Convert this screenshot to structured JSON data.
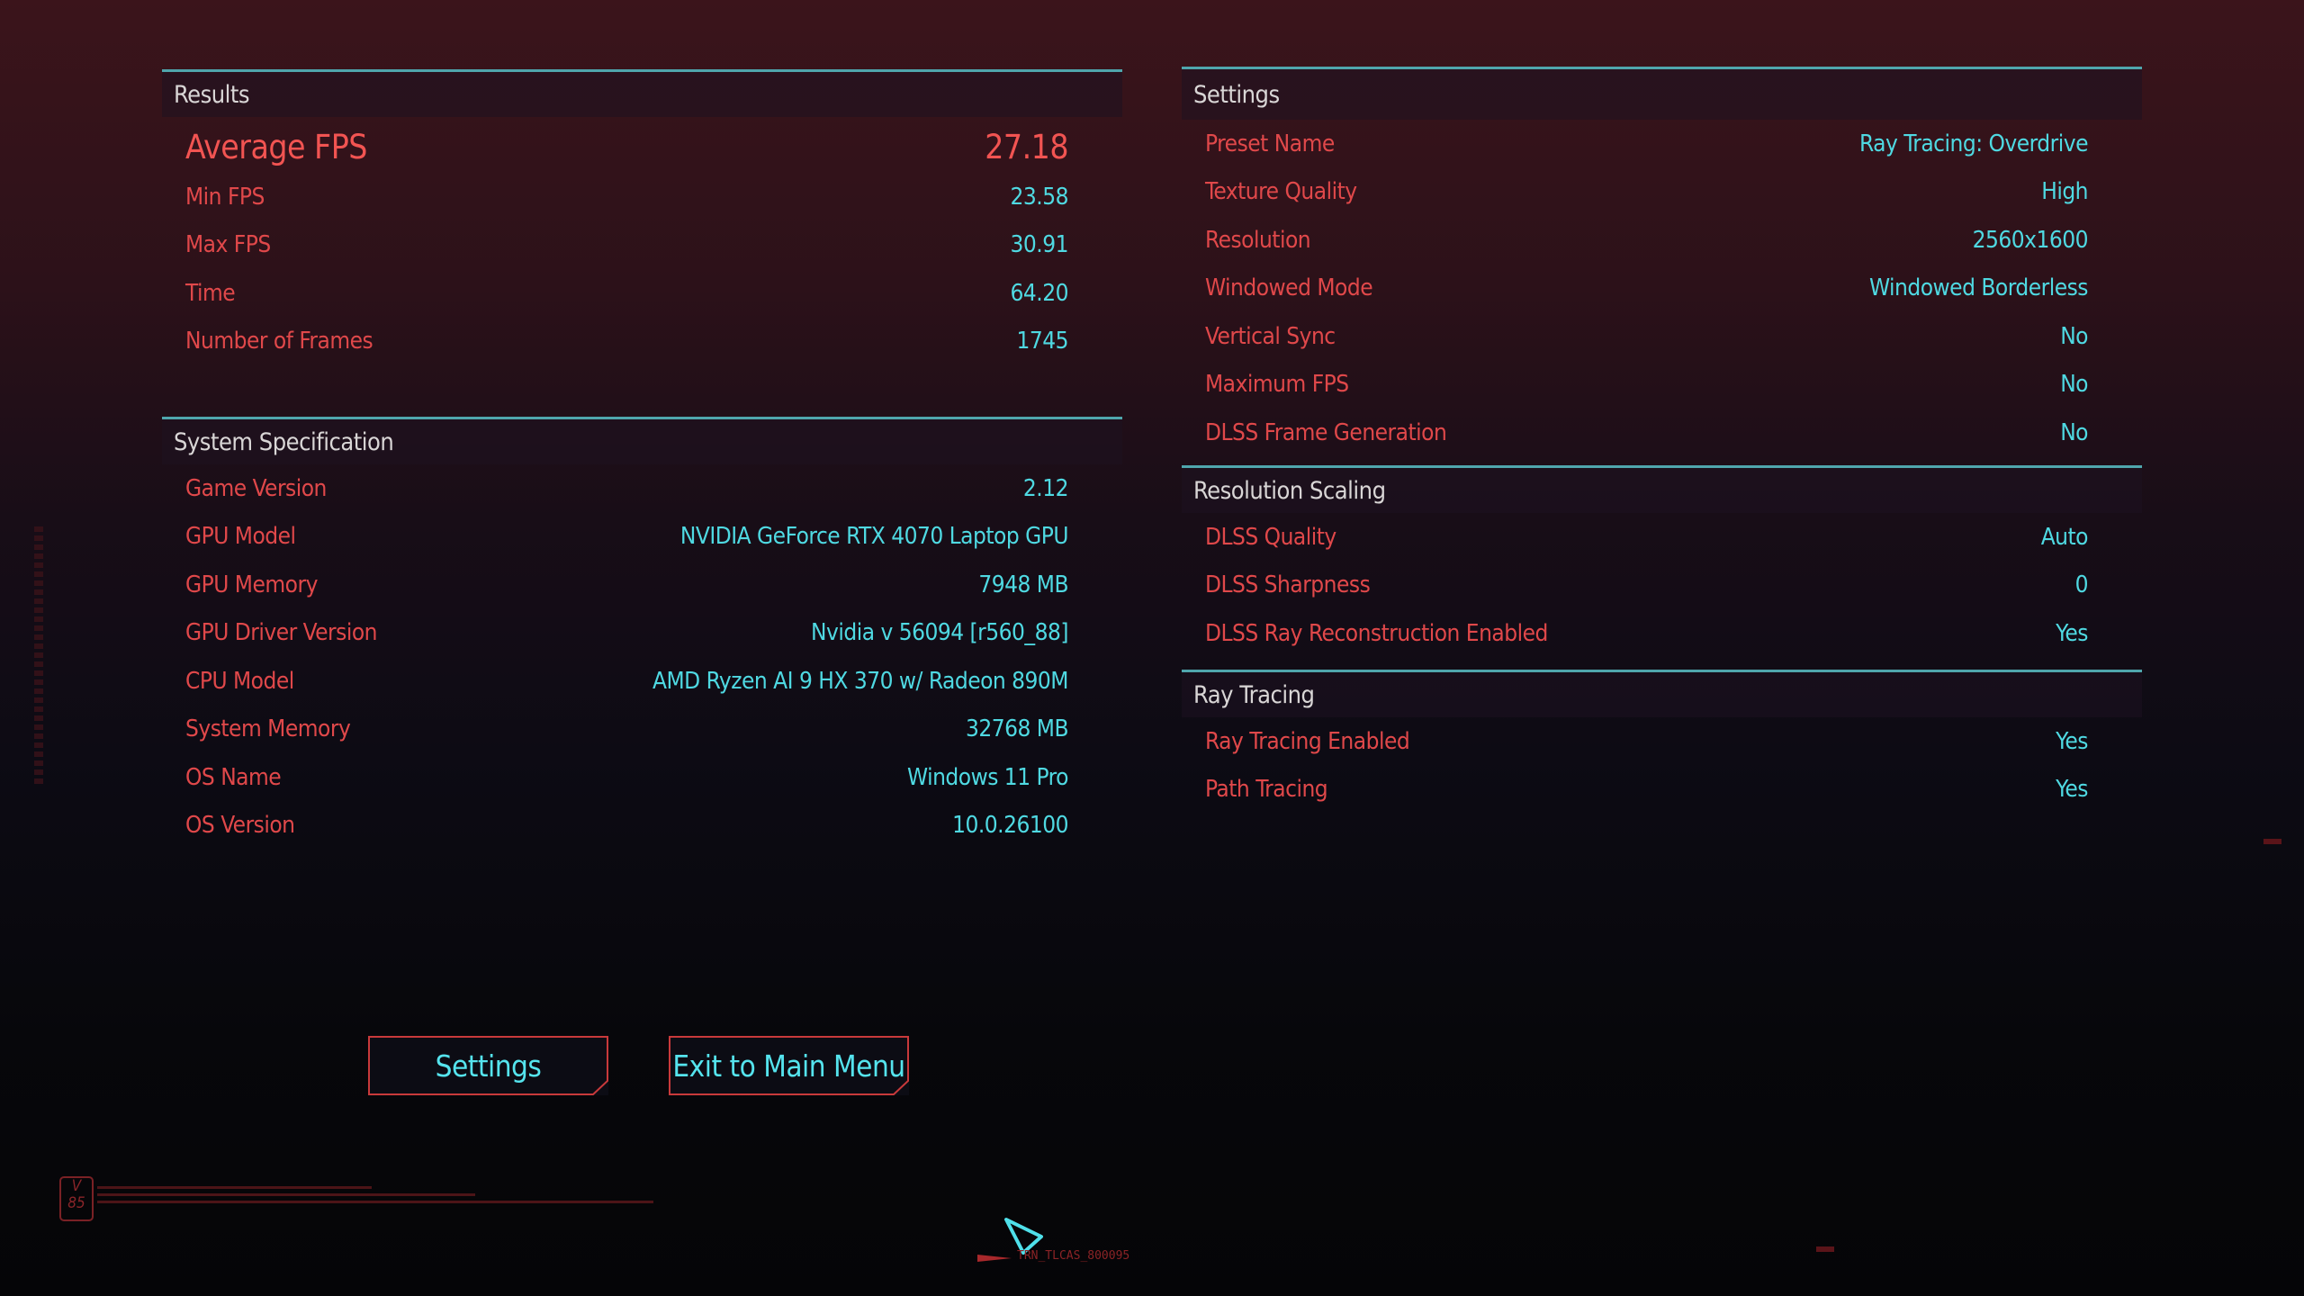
{
  "results": {
    "title": "Results",
    "average_fps": {
      "label": "Average FPS",
      "value": "27.18"
    },
    "rows": [
      {
        "label": "Min FPS",
        "value": "23.58"
      },
      {
        "label": "Max FPS",
        "value": "30.91"
      },
      {
        "label": "Time",
        "value": "64.20"
      },
      {
        "label": "Number of Frames",
        "value": "1745"
      }
    ]
  },
  "system_specification": {
    "title": "System Specification",
    "rows": [
      {
        "label": "Game Version",
        "value": "2.12"
      },
      {
        "label": "GPU Model",
        "value": "NVIDIA GeForce RTX 4070 Laptop GPU"
      },
      {
        "label": "GPU Memory",
        "value": "7948 MB"
      },
      {
        "label": "GPU Driver Version",
        "value": "Nvidia v 56094 [r560_88]"
      },
      {
        "label": "CPU Model",
        "value": "AMD Ryzen AI 9 HX 370 w/ Radeon 890M"
      },
      {
        "label": "System Memory",
        "value": "32768 MB"
      },
      {
        "label": "OS Name",
        "value": "Windows 11 Pro"
      },
      {
        "label": "OS Version",
        "value": "10.0.26100"
      }
    ]
  },
  "settings": {
    "title": "Settings",
    "rows": [
      {
        "label": "Preset Name",
        "value": "Ray Tracing: Overdrive"
      },
      {
        "label": "Texture Quality",
        "value": "High"
      },
      {
        "label": "Resolution",
        "value": "2560x1600"
      },
      {
        "label": "Windowed Mode",
        "value": "Windowed Borderless"
      },
      {
        "label": "Vertical Sync",
        "value": "No"
      },
      {
        "label": "Maximum FPS",
        "value": "No"
      },
      {
        "label": "DLSS Frame Generation",
        "value": "No"
      }
    ]
  },
  "resolution_scaling": {
    "title": "Resolution Scaling",
    "rows": [
      {
        "label": "DLSS Quality",
        "value": "Auto"
      },
      {
        "label": "DLSS Sharpness",
        "value": "0"
      },
      {
        "label": "DLSS Ray Reconstruction Enabled",
        "value": "Yes"
      }
    ]
  },
  "ray_tracing": {
    "title": "Ray Tracing",
    "rows": [
      {
        "label": "Ray Tracing Enabled",
        "value": "Yes"
      },
      {
        "label": "Path Tracing",
        "value": "Yes"
      }
    ]
  },
  "buttons": {
    "settings": "Settings",
    "exit": "Exit to Main Menu"
  },
  "footer": {
    "badge_top": "V",
    "badge_bottom": "85",
    "cursor_tag": "TRN_TLCAS_800095"
  },
  "colors": {
    "label": "#e0484a",
    "value": "#4fd9e2",
    "accent_line": "#4fa6ad",
    "highlight": "#f25452",
    "button_border": "#c8393b"
  }
}
